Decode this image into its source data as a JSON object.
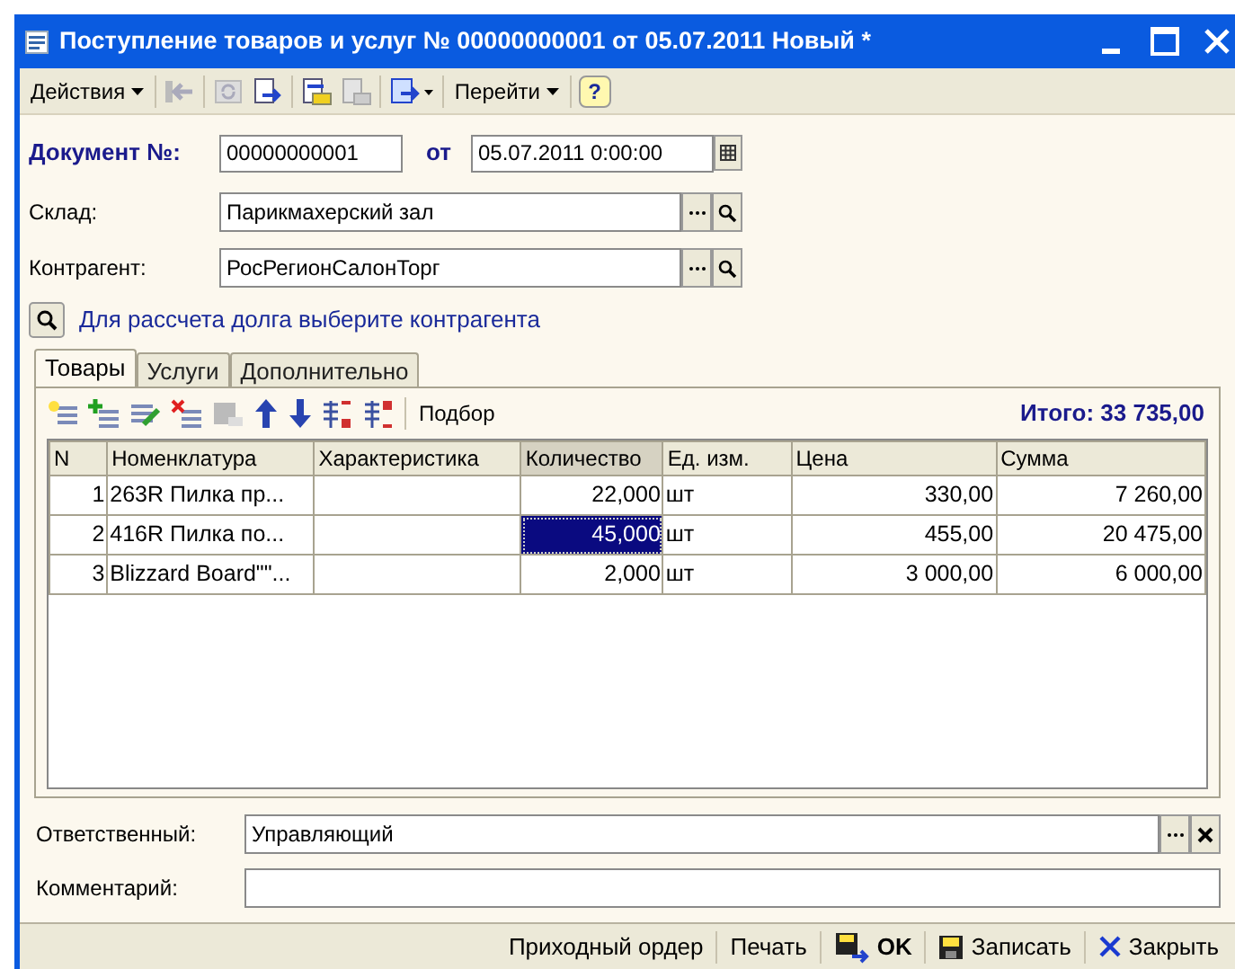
{
  "window": {
    "title": "Поступление товаров и услуг № 00000000001 от 05.07.2011 Новый *"
  },
  "toolbar": {
    "actions_menu": "Действия",
    "goto_menu": "Перейти",
    "help": "?"
  },
  "header": {
    "number_label": "Документ №:",
    "number": "00000000001",
    "date_label": "от",
    "date": "05.07.2011  0:00:00"
  },
  "fields": [
    {
      "label": "Склад:",
      "value": "Парикмахерский зал"
    },
    {
      "label": "Контрагент:",
      "value": "РосРегионСалонТорг"
    }
  ],
  "debt_hint": "Для рассчета долга выберите контрагента",
  "tabs": [
    {
      "label": "Товары",
      "selected": true
    },
    {
      "label": "Услуги",
      "selected": false
    },
    {
      "label": "Дополнительно",
      "selected": false
    }
  ],
  "table_toolbar": {
    "pick": "Подбор",
    "total": "Итого: 33 735,00"
  },
  "table": {
    "columns": [
      {
        "label": "N",
        "selected": false
      },
      {
        "label": "Номенклатура",
        "selected": false
      },
      {
        "label": "Характеристика",
        "selected": false
      },
      {
        "label": "Количество",
        "selected": true
      },
      {
        "label": "Ед. изм.",
        "selected": false
      },
      {
        "label": "Цена",
        "selected": false
      },
      {
        "label": "Сумма",
        "selected": false
      }
    ],
    "rows": [
      {
        "cells": [
          "1",
          "263R Пилка пр...",
          "",
          "22,000",
          "шт",
          "330,00",
          "7 260,00"
        ],
        "selected": false
      },
      {
        "cells": [
          "2",
          "416R Пилка по...",
          "",
          "45,000",
          "шт",
          "455,00",
          "20 475,00"
        ],
        "selected": true
      },
      {
        "cells": [
          "3",
          "Blizzard Board\"\"...",
          "",
          "2,000",
          "шт",
          "3 000,00",
          "6 000,00"
        ],
        "selected": false
      }
    ]
  },
  "responsible": {
    "label": "Ответственный:",
    "value": "Управляющий"
  },
  "comment": {
    "label": "Комментарий:"
  },
  "bottom_buttons": [
    {
      "kind": "text",
      "label": "Приходный ордер"
    },
    {
      "kind": "text",
      "label": "Печать"
    },
    {
      "kind": "ok",
      "label": "OK"
    },
    {
      "kind": "save",
      "label": "Записать"
    },
    {
      "kind": "close",
      "label": "Закрыть"
    }
  ]
}
